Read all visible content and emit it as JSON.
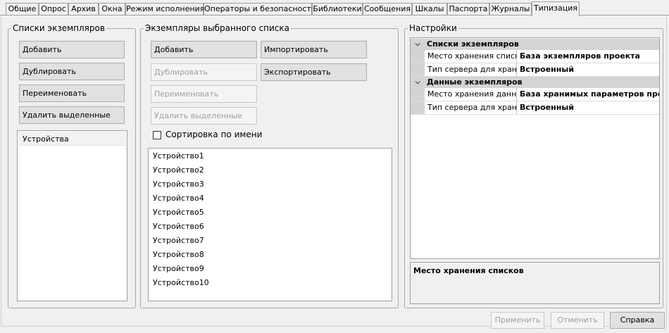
{
  "tabs": [
    {
      "label": "Общие"
    },
    {
      "label": "Опрос"
    },
    {
      "label": "Архив"
    },
    {
      "label": "Окна"
    },
    {
      "label": "Режим исполнения"
    },
    {
      "label": "Операторы и безопасность"
    },
    {
      "label": "Библиотеки"
    },
    {
      "label": "Сообщения"
    },
    {
      "label": "Шкалы"
    },
    {
      "label": "Паспорта"
    },
    {
      "label": "Журналы"
    },
    {
      "label": "Типизация"
    }
  ],
  "left_group": {
    "title": "Списки экземпляров",
    "buttons": {
      "add": "Добавить",
      "duplicate": "Дублировать",
      "rename": "Переименовать",
      "delete": "Удалить выделенные"
    },
    "items": [
      "Устройства"
    ]
  },
  "middle_group": {
    "title": "Экземпляры выбранного списка",
    "buttons": {
      "add": "Добавить",
      "duplicate": "Дублировать",
      "rename": "Переименовать",
      "delete": "Удалить выделенные",
      "import": "Импортировать",
      "export": "Экспортировать"
    },
    "sort_label": "Сортировка по имени",
    "sort_checked": false,
    "items": [
      "Устройство1",
      "Устройство2",
      "Устройство3",
      "Устройство4",
      "Устройство5",
      "Устройство6",
      "Устройство7",
      "Устройство8",
      "Устройство9",
      "Устройство10"
    ]
  },
  "settings": {
    "title": "Настройки",
    "categories": [
      {
        "name": "Списки экземпляров",
        "rows": [
          {
            "name": "Место хранения списков",
            "value": "База экземпляров проекта"
          },
          {
            "name": "Тип сервера для хранения",
            "value": "Встроенный"
          }
        ]
      },
      {
        "name": "Данные экземпляров",
        "rows": [
          {
            "name": "Место хранения данных",
            "value": "База хранимых параметров проекта"
          },
          {
            "name": "Тип сервера для хранения",
            "value": "Встроенный"
          }
        ]
      }
    ],
    "description": "Место хранения списков"
  },
  "footer": {
    "apply": "Применить",
    "cancel": "Отменить",
    "help": "Справка"
  }
}
